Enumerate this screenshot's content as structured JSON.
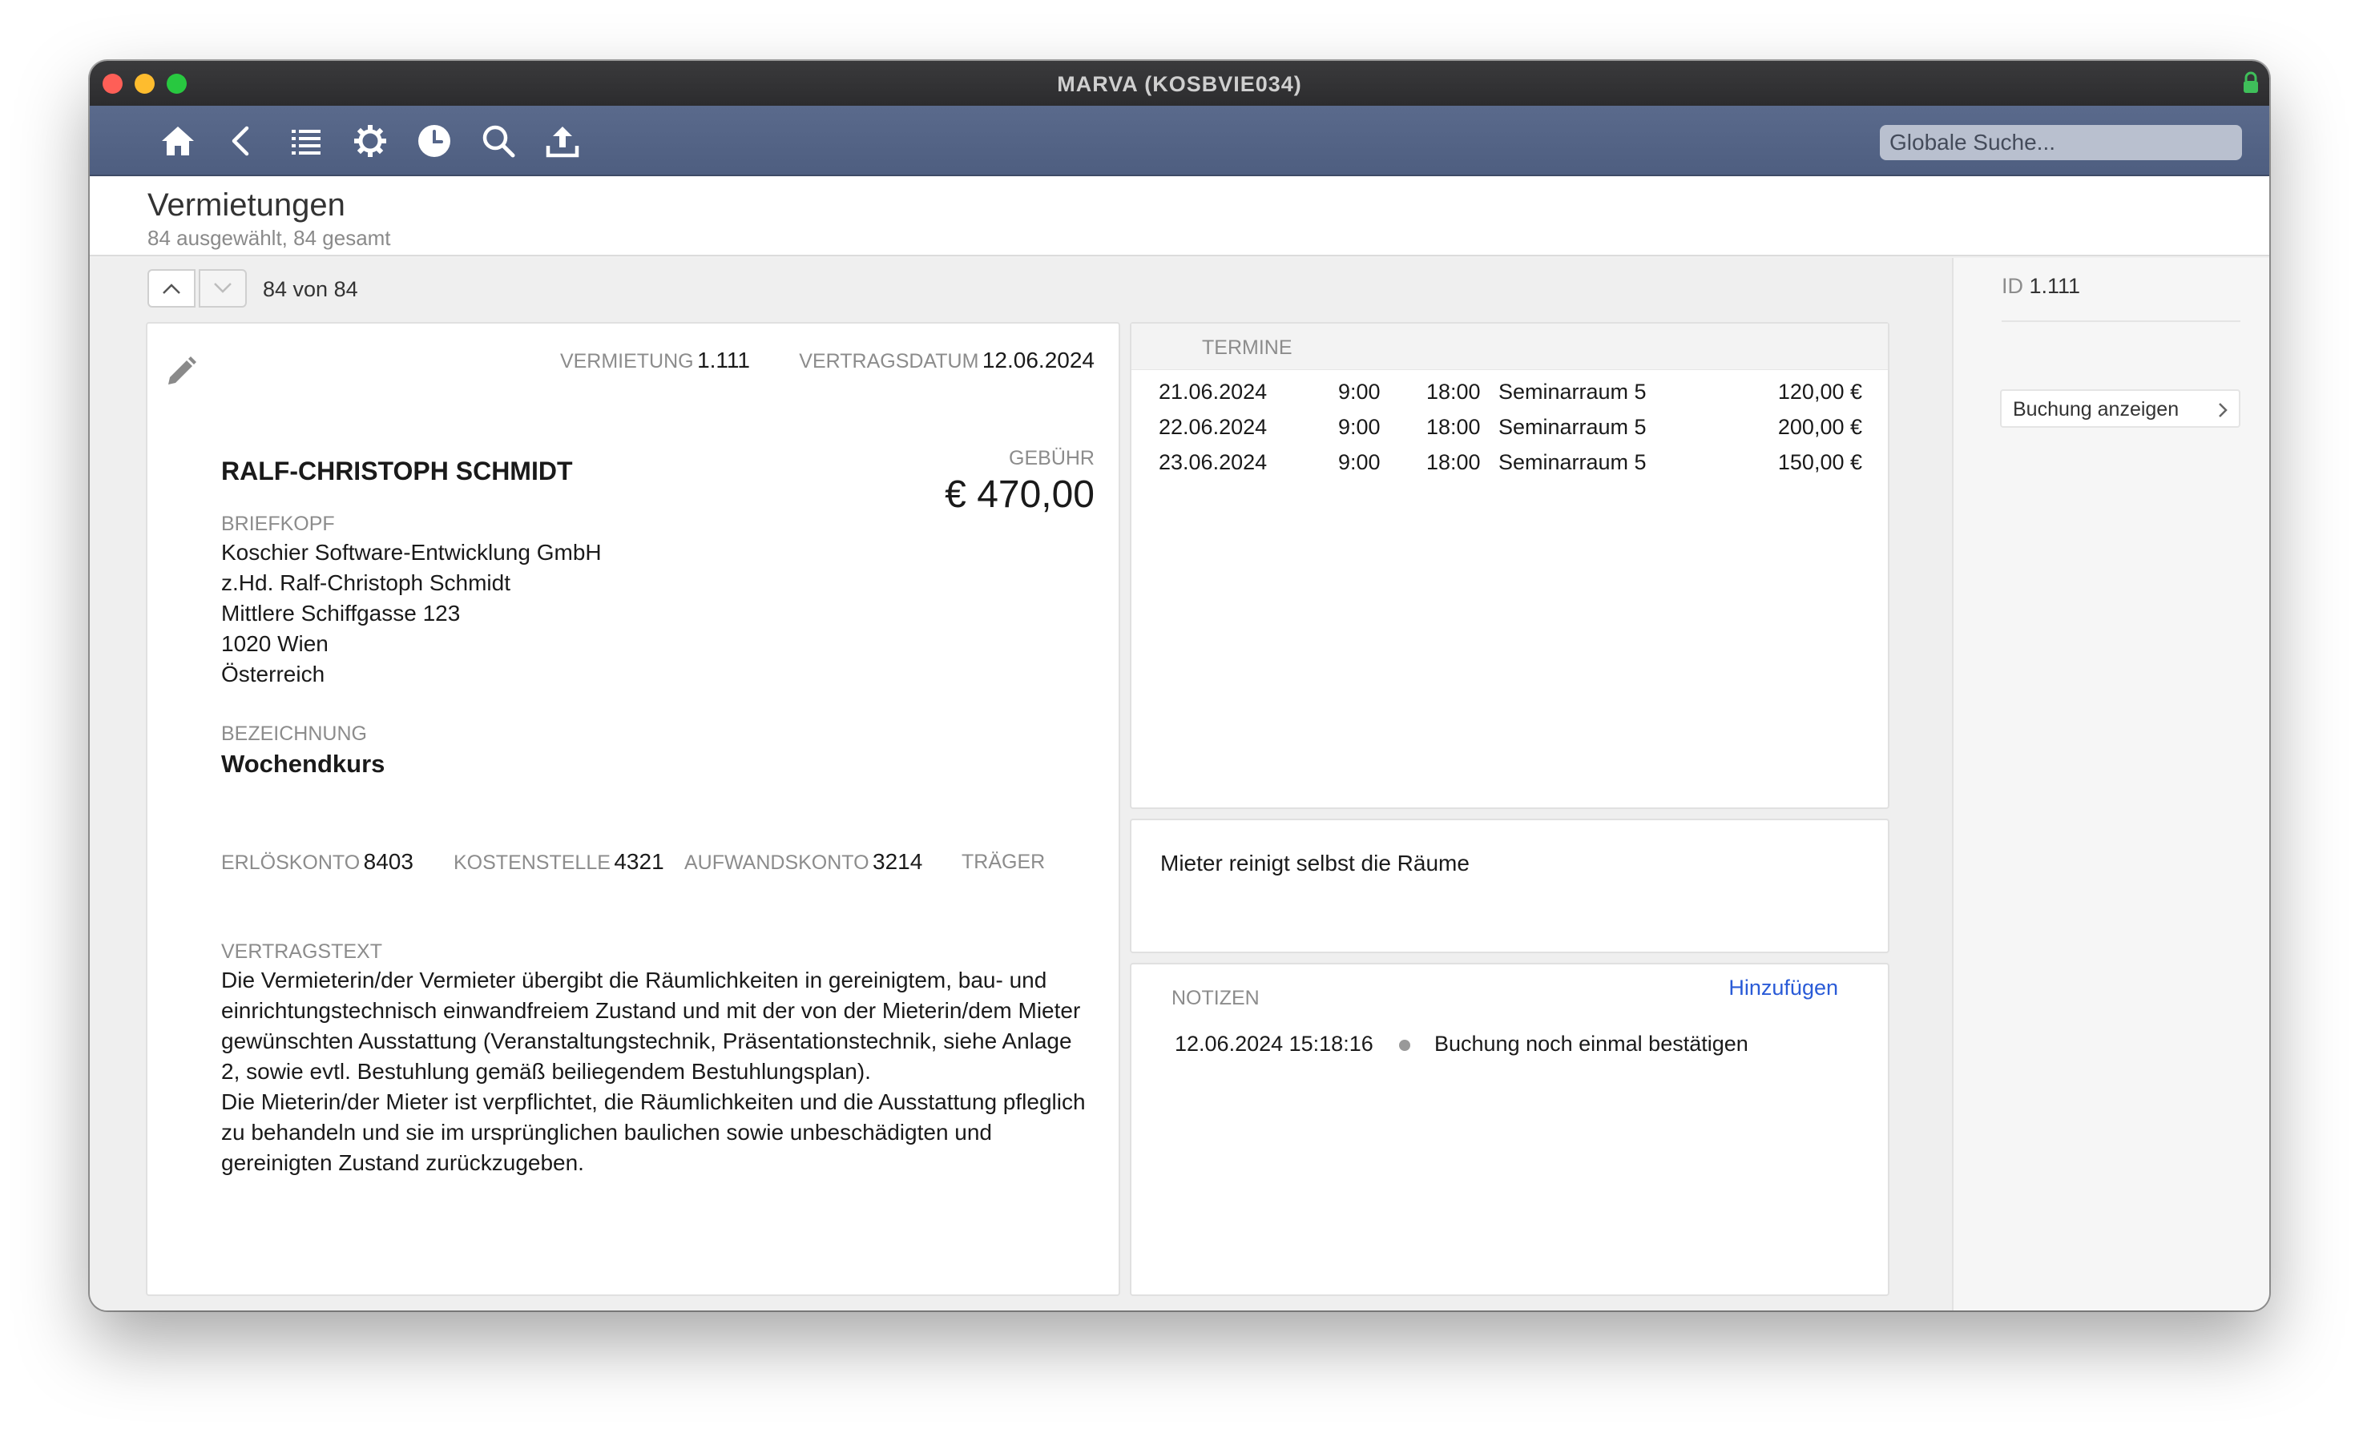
{
  "window": {
    "title": "MARVA (KOSBVIE034)"
  },
  "toolbar": {
    "buttons": [
      {
        "name": "home-icon"
      },
      {
        "name": "back-icon"
      },
      {
        "name": "list-icon"
      },
      {
        "name": "gear-icon"
      },
      {
        "name": "clock-icon"
      },
      {
        "name": "search-icon"
      },
      {
        "name": "upload-icon"
      }
    ],
    "search_placeholder": "Globale Suche..."
  },
  "header": {
    "title": "Vermietungen",
    "subtitle": "84 ausgewählt, 84 gesamt"
  },
  "navigation": {
    "count": "84 von 84"
  },
  "record": {
    "vermietung_label": "VERMIETUNG",
    "vermietung_value": "1.111",
    "vertragsdatum_label": "VERTRAGSDATUM",
    "vertragsdatum_value": "12.06.2024",
    "name": "RALF-CHRISTOPH SCHMIDT",
    "gebuehr_label": "GEBÜHR",
    "gebuehr_value": "€ 470,00",
    "briefkopf_label": "BRIEFKOPF",
    "briefkopf_lines": [
      "Koschier Software-Entwicklung GmbH",
      "z.Hd. Ralf-Christoph Schmidt",
      "Mittlere Schiffgasse 123",
      "1020 Wien",
      "Österreich"
    ],
    "bezeichnung_label": "BEZEICHNUNG",
    "bezeichnung_value": "Wochendkurs",
    "erloeskonto_label": "ERLÖSKONTO",
    "erloeskonto_value": "8403",
    "kostenstelle_label": "KOSTENSTELLE",
    "kostenstelle_value": "4321",
    "aufwandskonto_label": "AUFWANDSKONTO",
    "aufwandskonto_value": "3214",
    "traeger_label": "TRÄGER",
    "vertragstext_label": "VERTRAGSTEXT",
    "vertragstext_lines": [
      "Die Vermieterin/der Vermieter übergibt die Räumlichkeiten in gereinigtem, bau- und",
      "einrichtungstechnisch einwandfreiem Zustand und mit der von der Mieterin/dem Mieter",
      "gewünschten Ausstattung (Veranstaltungstechnik, Präsentationstechnik, siehe Anlage",
      "2, sowie evtl. Bestuhlung gemäß beiliegendem Bestuhlungsplan).",
      "Die Mieterin/der Mieter ist verpflichtet, die Räumlichkeiten und die Ausstattung pfleglich",
      "zu behandeln und sie im ursprünglichen baulichen sowie unbeschädigten und",
      "gereinigten Zustand zurückzugeben."
    ]
  },
  "termine": {
    "label": "TERMINE",
    "rows": [
      {
        "date": "21.06.2024",
        "start": "9:00",
        "end": "18:00",
        "room": "Seminarraum 5",
        "price": "120,00 €"
      },
      {
        "date": "22.06.2024",
        "start": "9:00",
        "end": "18:00",
        "room": "Seminarraum 5",
        "price": "200,00 €"
      },
      {
        "date": "23.06.2024",
        "start": "9:00",
        "end": "18:00",
        "room": "Seminarraum 5",
        "price": "150,00 €"
      }
    ]
  },
  "hint": {
    "text": "Mieter reinigt selbst die Räume"
  },
  "notizen": {
    "label": "NOTIZEN",
    "add_label": "Hinzufügen",
    "items": [
      {
        "timestamp": "12.06.2024 15:18:16",
        "text": "Buchung noch einmal bestätigen"
      }
    ]
  },
  "right_panel": {
    "id_label": "ID",
    "id_value": "1.111",
    "button_label": "Buchung anzeigen"
  },
  "colors": {
    "toolbar": "#56668a",
    "link": "#2a5bd7",
    "titlebar": "#2f2f31"
  }
}
